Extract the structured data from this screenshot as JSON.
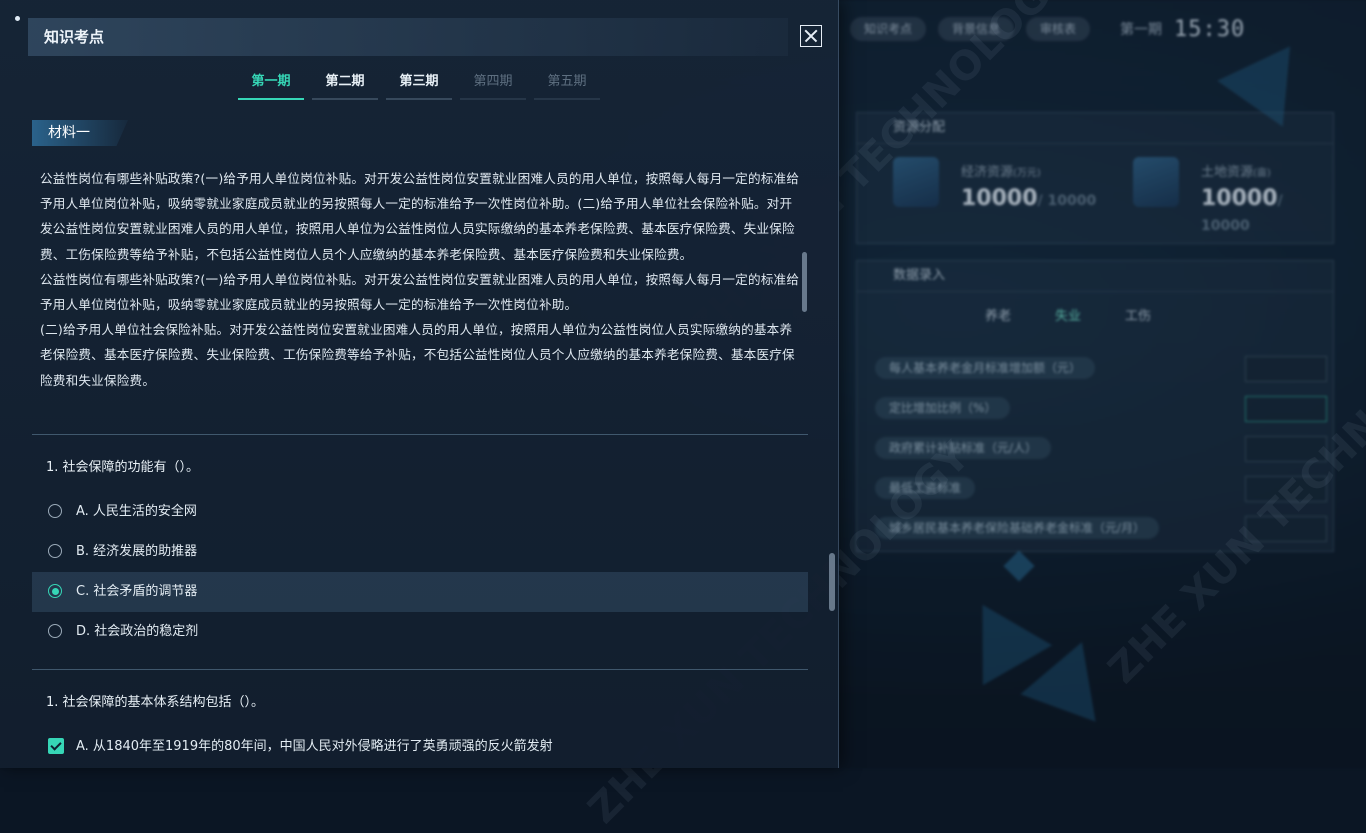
{
  "modal": {
    "title": "知识考点",
    "tabs": [
      {
        "label": "第一期",
        "state": "active"
      },
      {
        "label": "第二期",
        "state": "normal"
      },
      {
        "label": "第三期",
        "state": "normal"
      },
      {
        "label": "第四期",
        "state": "disabled"
      },
      {
        "label": "第五期",
        "state": "disabled"
      }
    ],
    "material": {
      "title": "材料一",
      "paragraphs": [
        "公益性岗位有哪些补贴政策?(一)给予用人单位岗位补贴。对开发公益性岗位安置就业困难人员的用人单位，按照每人每月一定的标准给予用人单位岗位补贴，吸纳零就业家庭成员就业的另按照每人一定的标准给予一次性岗位补助。(二)给予用人单位社会保险补贴。对开发公益性岗位安置就业困难人员的用人单位，按照用人单位为公益性岗位人员实际缴纳的基本养老保险费、基本医疗保险费、失业保险费、工伤保险费等给予补贴，不包括公益性岗位人员个人应缴纳的基本养老保险费、基本医疗保险费和失业保险费。",
        "公益性岗位有哪些补贴政策?(一)给予用人单位岗位补贴。对开发公益性岗位安置就业困难人员的用人单位，按照每人每月一定的标准给予用人单位岗位补贴，吸纳零就业家庭成员就业的另按照每人一定的标准给予一次性岗位补助。",
        "(二)给予用人单位社会保险补贴。对开发公益性岗位安置就业困难人员的用人单位，按照用人单位为公益性岗位人员实际缴纳的基本养老保险费、基本医疗保险费、失业保险费、工伤保险费等给予补贴，不包括公益性岗位人员个人应缴纳的基本养老保险费、基本医疗保险费和失业保险费。"
      ]
    },
    "questions": [
      {
        "title": "1. 社会保障的功能有（）。",
        "type": "radio",
        "options": [
          {
            "label": "A.  人民生活的安全网",
            "checked": false
          },
          {
            "label": "B.  经济发展的助推器",
            "checked": false
          },
          {
            "label": "C.  社会矛盾的调节器",
            "checked": true
          },
          {
            "label": "D.  社会政治的稳定剂",
            "checked": false
          }
        ]
      },
      {
        "title": "1. 社会保障的基本体系结构包括（）。",
        "type": "checkbox",
        "options": [
          {
            "label": "A.  从1840年至1919年的80年间，中国人民对外侵略进行了英勇顽强的反火箭发射",
            "checked": true
          }
        ]
      }
    ]
  },
  "background": {
    "top_pills": [
      "知识考点",
      "背景信息",
      "审核表"
    ],
    "period": "第一期",
    "time": "15:30",
    "resource_panel": {
      "title": "资源分配",
      "items": [
        {
          "label": "经济资源",
          "unit": "(万元)",
          "value": "10000",
          "total": "/ 10000"
        },
        {
          "label": "土地资源",
          "unit": "(亩)",
          "value": "10000",
          "total": "/ 10000"
        }
      ]
    },
    "data_panel": {
      "title": "数据录入",
      "tabs": [
        "养老",
        "失业",
        "工伤"
      ],
      "rows": [
        "每人基本养老金月标准增加额（元）",
        "定比增加比例（%）",
        "政府累计补贴标准（元/人）",
        "最低工资标准",
        "城乡居民基本养老保险基础养老金标准（元/月）"
      ]
    },
    "watermark": "ZHE XUN TECHNOLOGY"
  },
  "colors": {
    "accent": "#36d6b6",
    "modal_bg": "#16243a",
    "text": "#dfe8f0"
  }
}
